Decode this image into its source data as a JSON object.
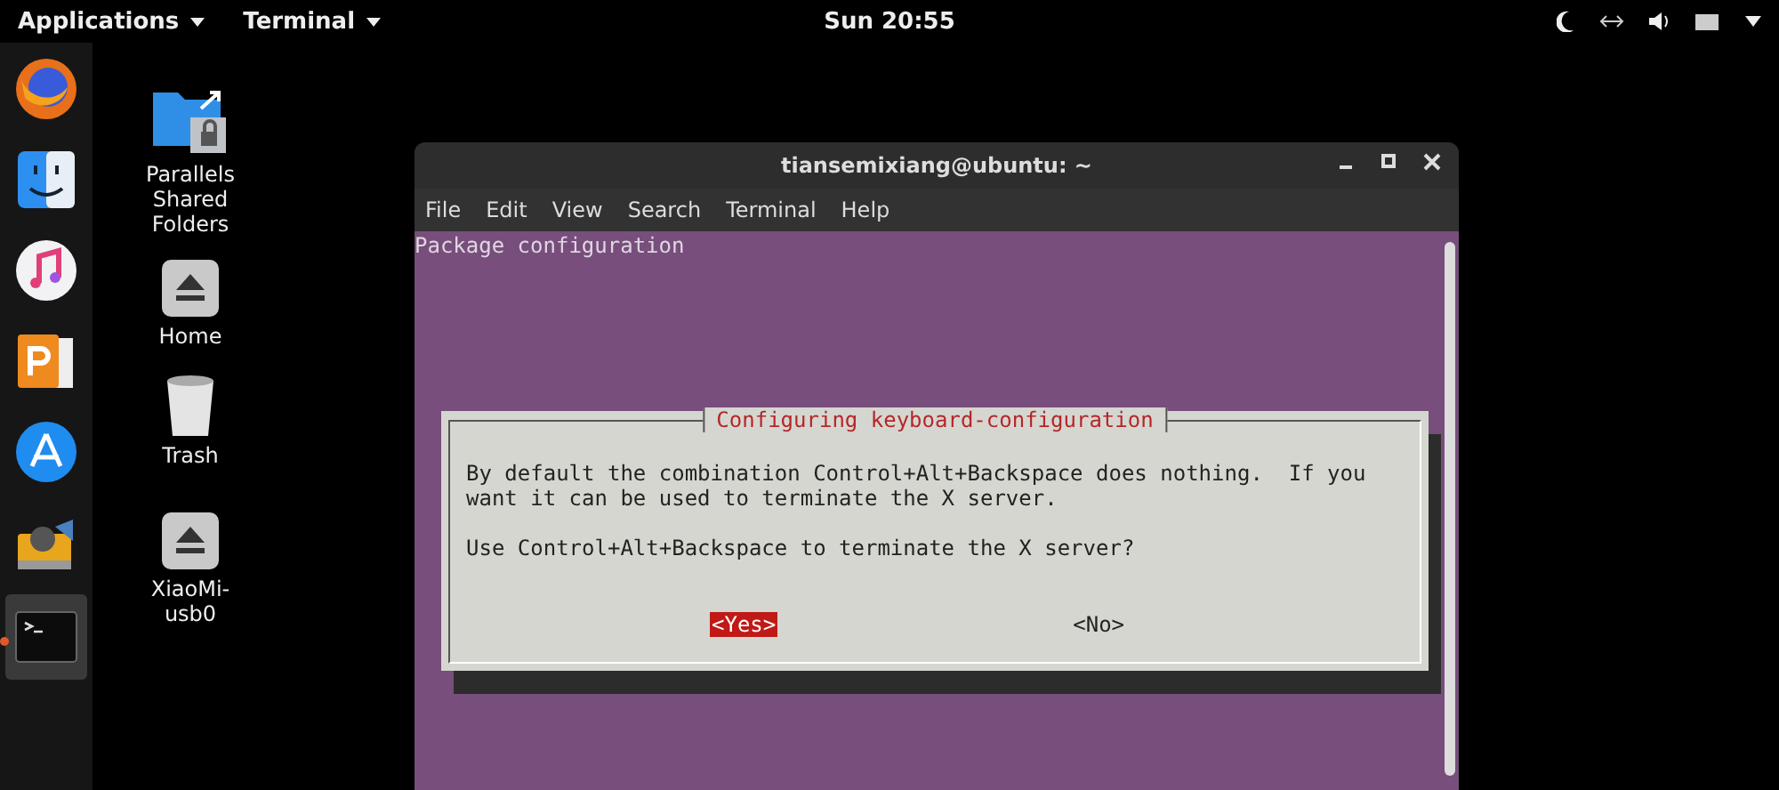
{
  "top_bar": {
    "applications_menu": "Applications",
    "app_menu": "Terminal",
    "clock": "Sun 20:55"
  },
  "dock": [
    {
      "kind": "browser",
      "selected": false,
      "running": false
    },
    {
      "kind": "finder",
      "selected": false,
      "running": false
    },
    {
      "kind": "music",
      "selected": false,
      "running": false
    },
    {
      "kind": "presentation",
      "selected": false,
      "running": false
    },
    {
      "kind": "store",
      "selected": false,
      "running": false
    },
    {
      "kind": "usb-drive",
      "selected": false,
      "running": false
    },
    {
      "kind": "terminal",
      "selected": true,
      "running": true
    }
  ],
  "desktop_icons": [
    {
      "kind": "shared-folder",
      "label": "Parallels\nShared\nFolders"
    },
    {
      "kind": "drive",
      "label": "Home"
    },
    {
      "kind": "trash",
      "label": "Trash"
    },
    {
      "kind": "drive",
      "label": "XiaoMi-\nusb0"
    }
  ],
  "window": {
    "title": "tiansemixiang@ubuntu: ~",
    "menu": [
      "File",
      "Edit",
      "View",
      "Search",
      "Terminal",
      "Help"
    ],
    "header_line": "Package configuration",
    "dialog": {
      "title": "Configuring keyboard-configuration",
      "body": [
        [
          "By default the combination Control+Alt+Backspace does nothing.  If you",
          "want it can be used to terminate the X server."
        ],
        [
          "Use Control+Alt+Backspace to terminate the X server?"
        ]
      ],
      "buttons": [
        {
          "label": "<Yes>",
          "selected": true
        },
        {
          "label": "<No>",
          "selected": false
        }
      ]
    }
  }
}
